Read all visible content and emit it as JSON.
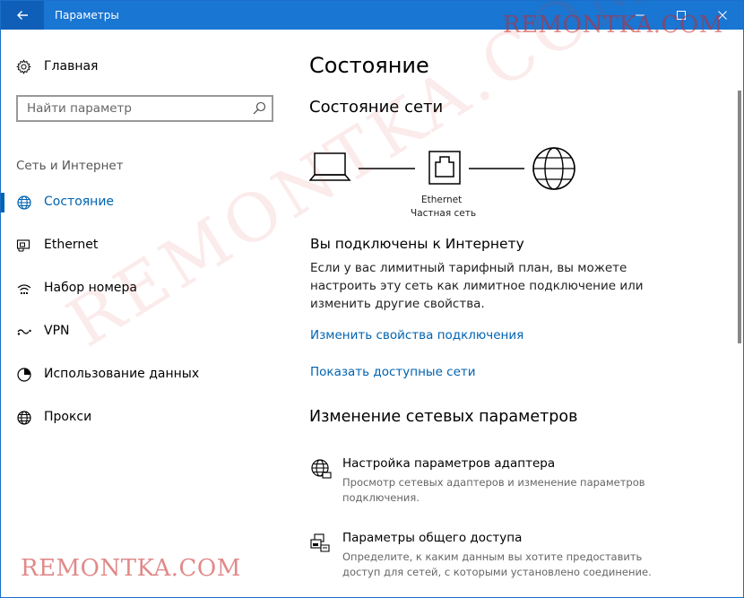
{
  "window": {
    "title": "Параметры"
  },
  "sidebar": {
    "home_label": "Главная",
    "search_placeholder": "Найти параметр",
    "section_label": "Сеть и Интернет",
    "items": [
      {
        "label": "Состояние",
        "icon": "globe-icon",
        "active": true
      },
      {
        "label": "Ethernet",
        "icon": "ethernet-icon",
        "active": false
      },
      {
        "label": "Набор номера",
        "icon": "dialup-icon",
        "active": false
      },
      {
        "label": "VPN",
        "icon": "vpn-icon",
        "active": false
      },
      {
        "label": "Использование данных",
        "icon": "data-usage-icon",
        "active": false
      },
      {
        "label": "Прокси",
        "icon": "globe-icon",
        "active": false
      }
    ]
  },
  "main": {
    "title": "Состояние",
    "network_status_heading": "Состояние сети",
    "diagram": {
      "adapter_label": "Ethernet",
      "network_label": "Частная сеть"
    },
    "connected_heading": "Вы подключены к Интернету",
    "connected_desc": "Если у вас лимитный тарифный план, вы можете настроить эту сеть как лимитное подключение или изменить другие свойства.",
    "link_change_props": "Изменить свойства подключения",
    "link_show_networks": "Показать доступные сети",
    "change_heading": "Изменение сетевых параметров",
    "settings": [
      {
        "title": "Настройка параметров адаптера",
        "desc": "Просмотр сетевых адаптеров и изменение параметров подключения.",
        "icon": "adapter-globe-icon"
      },
      {
        "title": "Параметры общего доступа",
        "desc": "Определите, к каким данным вы хотите предоставить доступ для сетей, с которыми установлено соединение.",
        "icon": "sharing-icon"
      }
    ]
  },
  "watermark": {
    "top": "REMONTKA.COM",
    "bottom": "REMONTKA.COM",
    "diagonal": "REMONTKA.COM"
  },
  "colors": {
    "titlebar": "#1976d2",
    "accent": "#0063b1"
  }
}
